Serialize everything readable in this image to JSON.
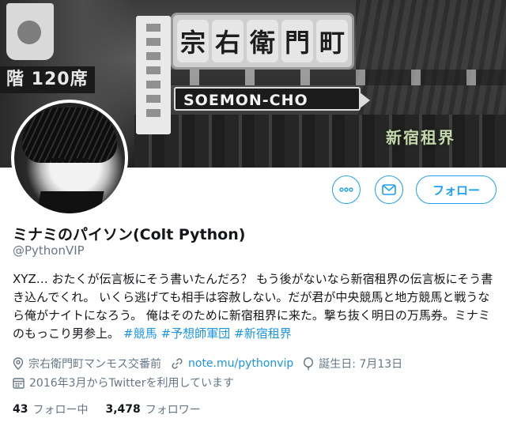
{
  "banner": {
    "cup_label": "",
    "seat_sign": "階 120席",
    "gate_chars": [
      "宗",
      "右",
      "衛",
      "門",
      "町"
    ],
    "street_sign": "SOEMON-CHO",
    "stamp": "新宿租界"
  },
  "profile": {
    "name": "ミナミのパイソン(Colt Python)",
    "handle": "@PythonVIP",
    "bio_text": "XYZ… おたくが伝言板にそう書いたんだろ？ もう後がないなら新宿租界の伝言板にそう書き込んでくれ。 いくら逃げても相手は容赦しない。だが君が中央競馬と地方競馬と戦うなら俺がナイトになろう。 俺はそのために新宿租界に来た。撃ち抜く明日の万馬券。ミナミのもっこり男参上。",
    "hashtags": [
      "#競馬",
      "#予想師軍団",
      "#新宿租界"
    ],
    "location": "宗右衛門町マンモス交番前",
    "url": "note.mu/pythonvip",
    "birthday": "誕生日: 7月13日",
    "joined": "2016年3月からTwitterを利用しています"
  },
  "actions": {
    "more_icon": "more-icon",
    "mail_icon": "envelope-icon",
    "follow_label": "フォロー"
  },
  "stats": {
    "following_count": "43",
    "following_label": "フォロー中",
    "followers_count": "3,478",
    "followers_label": "フォロワー"
  },
  "colors": {
    "accent": "#1da1f2",
    "link": "#1b95e0",
    "secondary_text": "#657786",
    "primary_text": "#14171a"
  }
}
